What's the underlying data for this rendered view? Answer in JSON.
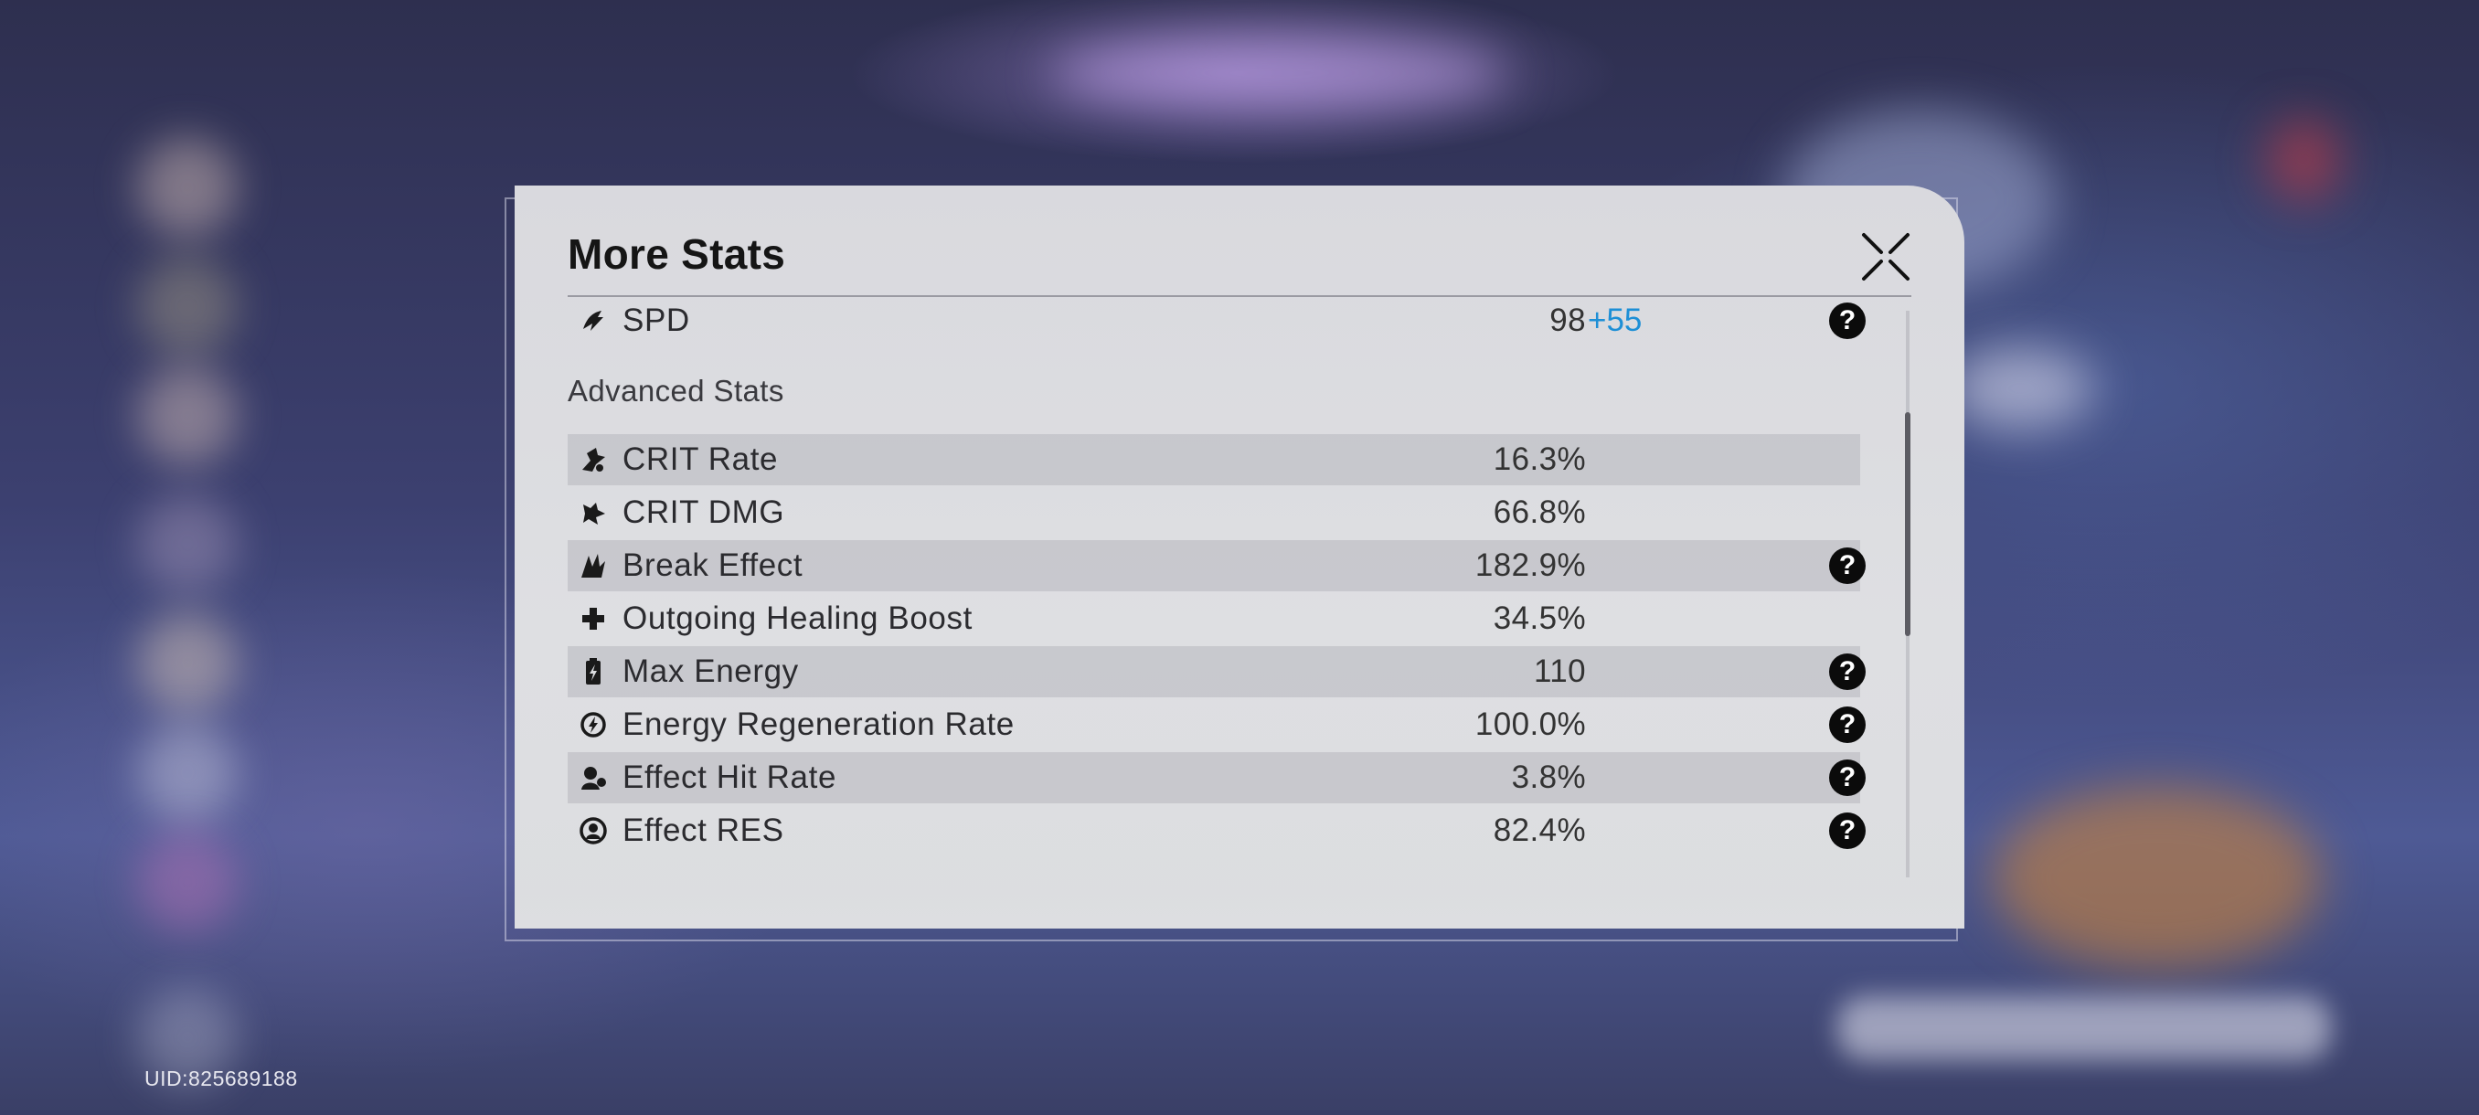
{
  "footer": {
    "uid": "UID:825689188"
  },
  "panel": {
    "title": "More Stats",
    "close_icon": "close-x-icon",
    "base_stats": [
      {
        "label": "SPD",
        "value": "98",
        "bonus": "+55",
        "icon": "spd-icon",
        "help": true
      }
    ],
    "advanced_title": "Advanced Stats",
    "advanced_stats": [
      {
        "label": "CRIT Rate",
        "value": "16.3%",
        "icon": "crit-rate-icon",
        "help": false
      },
      {
        "label": "CRIT DMG",
        "value": "66.8%",
        "icon": "crit-dmg-icon",
        "help": false
      },
      {
        "label": "Break Effect",
        "value": "182.9%",
        "icon": "break-effect-icon",
        "help": true
      },
      {
        "label": "Outgoing Healing Boost",
        "value": "34.5%",
        "icon": "healing-cross-icon",
        "help": false
      },
      {
        "label": "Max Energy",
        "value": "110",
        "icon": "energy-battery-icon",
        "help": true
      },
      {
        "label": "Energy Regeneration Rate",
        "value": "100.0%",
        "icon": "energy-regen-icon",
        "help": true
      },
      {
        "label": "Effect Hit Rate",
        "value": "3.8%",
        "icon": "effect-hit-icon",
        "help": true
      },
      {
        "label": "Effect RES",
        "value": "82.4%",
        "icon": "effect-res-icon",
        "help": true
      }
    ],
    "help_glyph": "?",
    "colors": {
      "bonus": "#1d8fd6",
      "panel_bg": "#dcdde0"
    }
  }
}
